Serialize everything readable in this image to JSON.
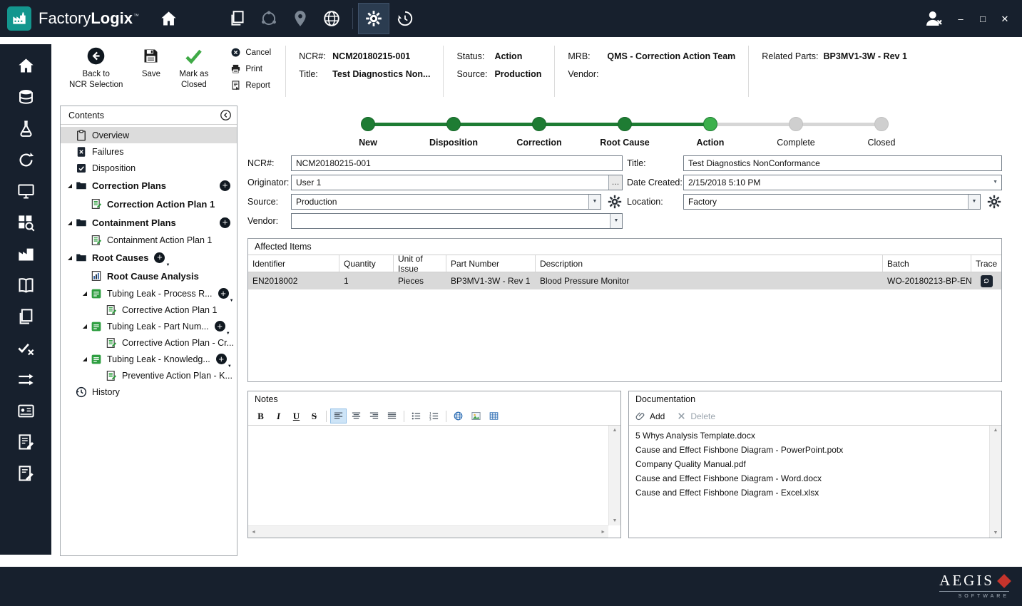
{
  "titlebar": {
    "brand_regular": "Factory",
    "brand_bold": "Logix",
    "trademark": "™",
    "window_controls": {
      "minimize": "–",
      "maximize": "□",
      "close": "✕"
    }
  },
  "topbar": {
    "icons": [
      {
        "name": "documents"
      },
      {
        "name": "network"
      },
      {
        "name": "location"
      },
      {
        "name": "globe"
      },
      {
        "type": "sep"
      },
      {
        "name": "settings",
        "active": true
      },
      {
        "name": "history"
      }
    ]
  },
  "sidebar": {
    "items": [
      {
        "icon": "home"
      },
      {
        "icon": "database"
      },
      {
        "icon": "lab"
      },
      {
        "icon": "refresh"
      },
      {
        "icon": "monitor"
      },
      {
        "icon": "grid-search"
      },
      {
        "icon": "factory"
      },
      {
        "icon": "book"
      },
      {
        "icon": "pages"
      },
      {
        "icon": "check-x"
      },
      {
        "icon": "flow"
      },
      {
        "icon": "card"
      },
      {
        "icon": "edit-doc"
      },
      {
        "icon": "edit-doc-2"
      }
    ]
  },
  "toolbar": {
    "back": {
      "line1": "Back to",
      "line2": "NCR Selection"
    },
    "save_label": "Save",
    "mark_closed": {
      "line1": "Mark as",
      "line2": "Closed"
    },
    "cancel_label": "Cancel",
    "print_label": "Print",
    "report_label": "Report",
    "info": {
      "ncr_label": "NCR#:",
      "ncr_value": "NCM20180215-001",
      "title_label": "Title:",
      "title_value": "Test Diagnostics Non...",
      "status_label": "Status:",
      "status_value": "Action",
      "source_label": "Source:",
      "source_value": "Production",
      "mrb_label": "MRB:",
      "mrb_value": "QMS - Correction Action Team",
      "vendor_label": "Vendor:",
      "vendor_value": "",
      "related_label": "Related Parts:",
      "related_value": "BP3MV1-3W - Rev 1"
    }
  },
  "contents": {
    "title": "Contents",
    "tree": [
      {
        "label": "Overview",
        "icon": "clipboard",
        "indent": 0,
        "selected": true
      },
      {
        "label": "Failures",
        "icon": "failures",
        "indent": 0
      },
      {
        "label": "Disposition",
        "icon": "disposition",
        "indent": 0
      },
      {
        "label": "Correction Plans",
        "icon": "folder",
        "indent": 0,
        "bold": true,
        "expanded": true,
        "add": "right"
      },
      {
        "label": "Correction Action Plan 1",
        "icon": "plan",
        "indent": 1,
        "bold": true
      },
      {
        "label": "Containment Plans",
        "icon": "folder",
        "indent": 0,
        "bold": true,
        "expanded": true,
        "add": "right"
      },
      {
        "label": "Containment Action Plan 1",
        "icon": "plan",
        "indent": 1
      },
      {
        "label": "Root Causes",
        "icon": "folder",
        "indent": 0,
        "bold": true,
        "expanded": true,
        "add": "inline",
        "add_caret": true
      },
      {
        "label": "Root Cause Analysis",
        "icon": "analysis",
        "indent": 1,
        "bold": true
      },
      {
        "label": "Tubing Leak - Process R...",
        "icon": "root-cause",
        "indent": 1,
        "expanded": true,
        "add": "inline",
        "add_caret": true
      },
      {
        "label": "Corrective Action Plan 1",
        "icon": "plan",
        "indent": 2
      },
      {
        "label": "Tubing Leak - Part Num...",
        "icon": "root-cause",
        "indent": 1,
        "expanded": true,
        "add": "inline",
        "add_caret": true
      },
      {
        "label": "Corrective Action Plan - Cr...",
        "icon": "plan",
        "indent": 2
      },
      {
        "label": "Tubing Leak - Knowledg...",
        "icon": "root-cause",
        "indent": 1,
        "expanded": true,
        "add": "inline",
        "add_caret": true
      },
      {
        "label": "Preventive Action Plan - K...",
        "icon": "plan",
        "indent": 2
      },
      {
        "label": "History",
        "icon": "history",
        "indent": 0
      }
    ]
  },
  "stepper": {
    "steps": [
      {
        "label": "New",
        "state": "done"
      },
      {
        "label": "Disposition",
        "state": "done"
      },
      {
        "label": "Correction",
        "state": "done"
      },
      {
        "label": "Root Cause",
        "state": "done"
      },
      {
        "label": "Action",
        "state": "current"
      },
      {
        "label": "Complete",
        "state": "pending"
      },
      {
        "label": "Closed",
        "state": "pending"
      }
    ]
  },
  "form": {
    "ncr": {
      "label": "NCR#:",
      "value": "NCM20180215-001"
    },
    "title": {
      "label": "Title:",
      "value": "Test Diagnostics NonConformance"
    },
    "originator": {
      "label": "Originator:",
      "value": "User 1",
      "browse": "…"
    },
    "date_created": {
      "label": "Date Created:",
      "value": "2/15/2018 5:10 PM"
    },
    "source": {
      "label": "Source:",
      "value": "Production"
    },
    "location": {
      "label": "Location:",
      "value": "Factory"
    },
    "vendor": {
      "label": "Vendor:",
      "value": ""
    }
  },
  "affected_items": {
    "title": "Affected Items",
    "columns": [
      "Identifier",
      "Quantity",
      "Unit of Issue",
      "Part Number",
      "Description",
      "Batch",
      "Trace"
    ],
    "rows": [
      {
        "cells": [
          "EN2018002",
          "1",
          "Pieces",
          "BP3MV1-3W - Rev 1",
          "Blood Pressure Monitor",
          "WO-20180213-BP-EN"
        ],
        "trace": true,
        "selected": true
      }
    ]
  },
  "notes": {
    "title": "Notes",
    "content": "",
    "toolbar": [
      {
        "name": "bold",
        "label": "B"
      },
      {
        "name": "italic",
        "label": "I"
      },
      {
        "name": "underline",
        "label": "U"
      },
      {
        "name": "strikethrough",
        "label": "S"
      },
      {
        "type": "sep"
      },
      {
        "name": "align-left",
        "active": true
      },
      {
        "name": "align-center"
      },
      {
        "name": "align-right"
      },
      {
        "name": "align-justify"
      },
      {
        "type": "sep"
      },
      {
        "name": "bullet-list"
      },
      {
        "name": "numbered-list"
      },
      {
        "type": "sep"
      },
      {
        "name": "hyperlink"
      },
      {
        "name": "image"
      },
      {
        "name": "table"
      }
    ]
  },
  "documentation": {
    "title": "Documentation",
    "add_label": "Add",
    "delete_label": "Delete",
    "files": [
      "5 Whys Analysis Template.docx",
      "Cause and Effect Fishbone Diagram - PowerPoint.potx",
      "Company Quality Manual.pdf",
      "Cause and Effect Fishbone Diagram - Word.docx",
      "Cause and Effect Fishbone Diagram - Excel.xlsx"
    ]
  },
  "footer": {
    "brand": "AEGIS",
    "brand_sub": "SOFTWARE"
  }
}
